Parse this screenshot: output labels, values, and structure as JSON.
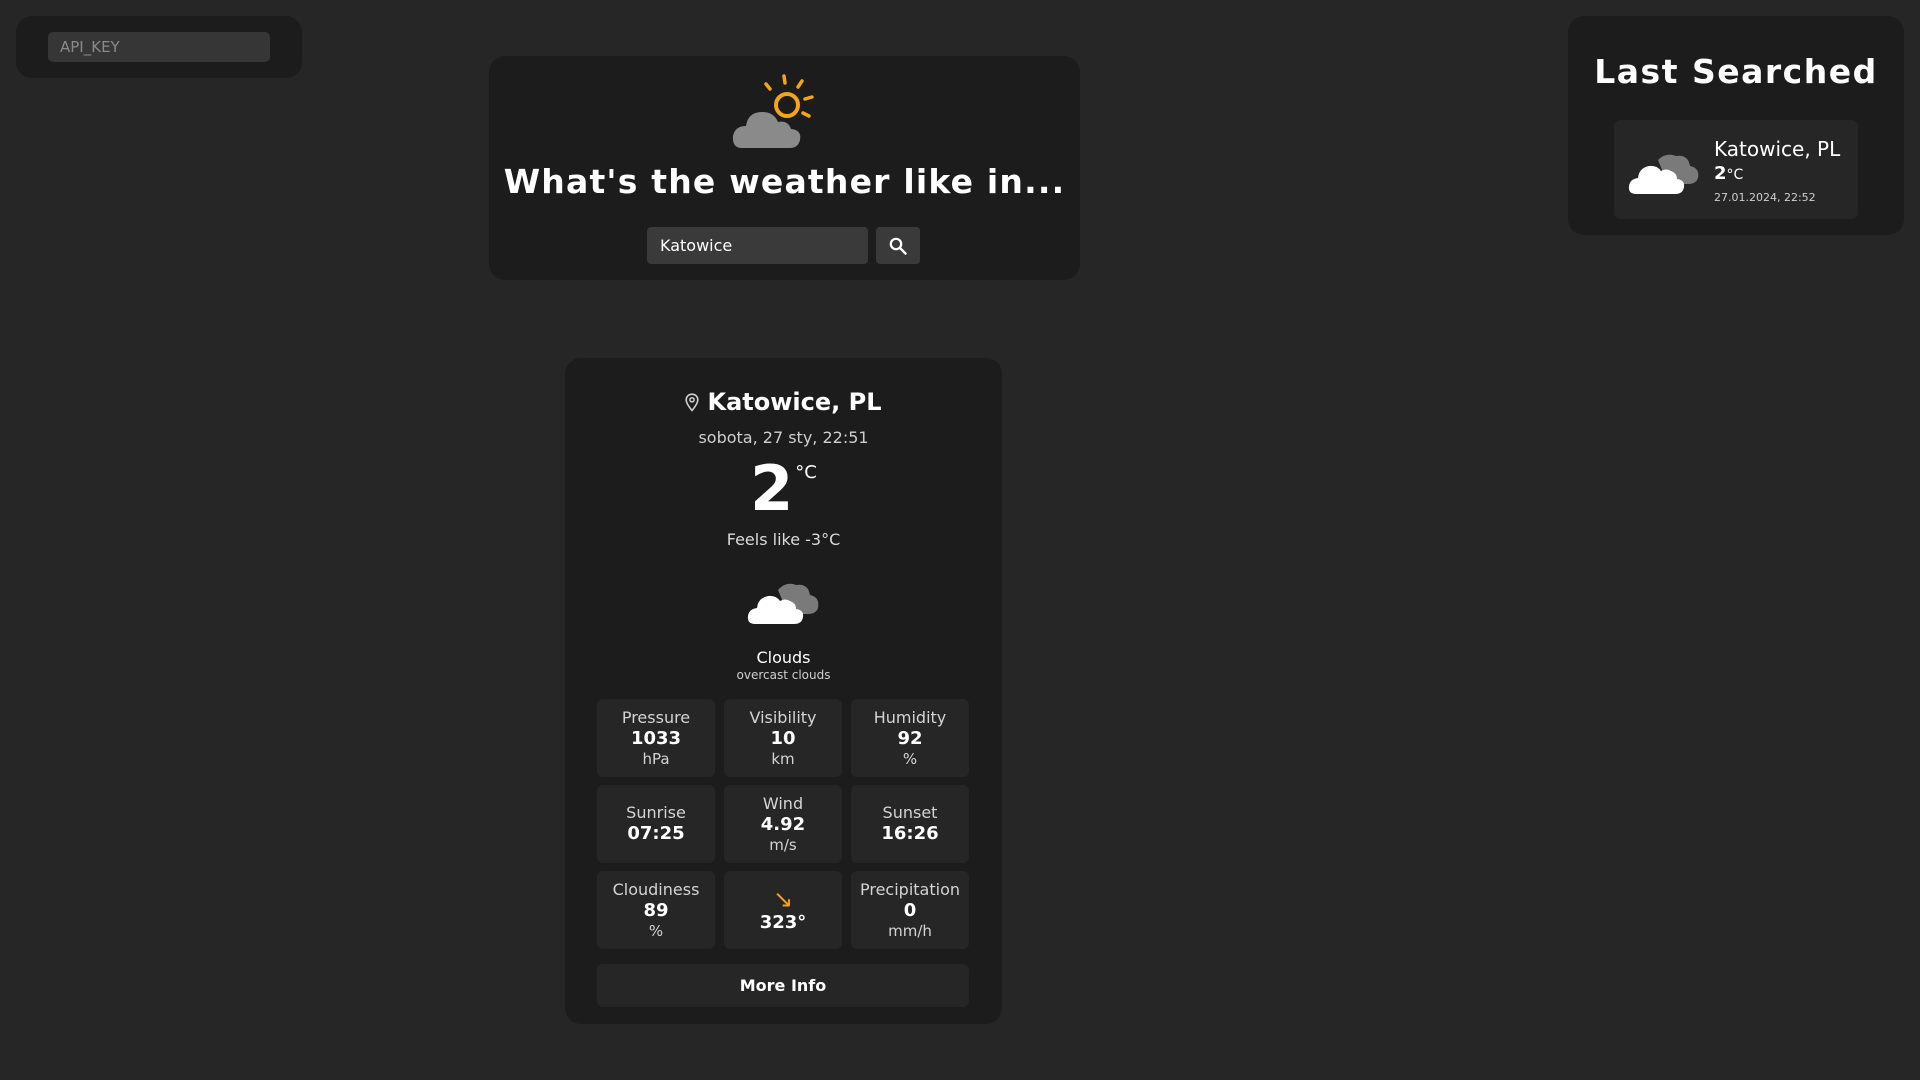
{
  "api": {
    "placeholder": "API_KEY"
  },
  "search": {
    "title": "What's the weather like in...",
    "value": "Katowice",
    "placeholder": ""
  },
  "last_searched": {
    "title": "Last Searched",
    "items": [
      {
        "city": "Katowice, PL",
        "temp": "2",
        "unit": "°C",
        "date": "27.01.2024, 22:52",
        "icon": "cloud-icon"
      }
    ]
  },
  "weather": {
    "city": "Katowice, PL",
    "date": "sobota, 27 sty, 22:51",
    "temp": "2",
    "temp_unit": "°C",
    "feels_like": "Feels like -3°C",
    "condition": "Clouds",
    "description": "overcast clouds",
    "icon": "cloud-icon",
    "tiles": {
      "pressure": {
        "label": "Pressure",
        "value": "1033",
        "unit": "hPa"
      },
      "visibility": {
        "label": "Visibility",
        "value": "10",
        "unit": "km"
      },
      "humidity": {
        "label": "Humidity",
        "value": "92",
        "unit": "%"
      },
      "sunrise": {
        "label": "Sunrise",
        "value": "07:25"
      },
      "wind": {
        "label": "Wind",
        "value": "4.92",
        "unit": "m/s"
      },
      "sunset": {
        "label": "Sunset",
        "value": "16:26"
      },
      "cloudiness": {
        "label": "Cloudiness",
        "value": "89",
        "unit": "%"
      },
      "wind_direction": {
        "value": "323°",
        "arrow": "↘"
      },
      "precipitation": {
        "label": "Precipitation",
        "value": "0",
        "unit": "mm/h"
      }
    },
    "more_info_label": "More Info"
  },
  "colors": {
    "background": "#262626",
    "panel": "#1c1c1c",
    "accent": "#f5a418",
    "cloud": "#8a8a8a"
  }
}
